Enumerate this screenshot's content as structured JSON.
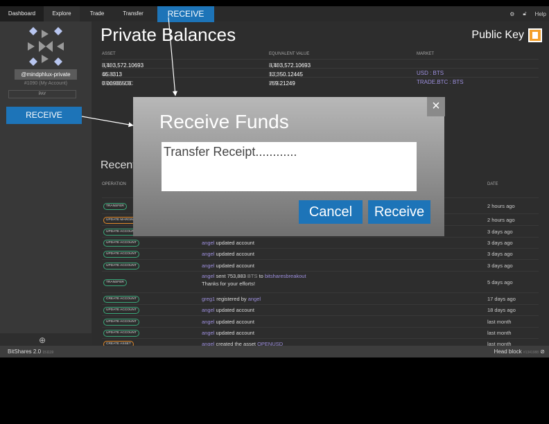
{
  "nav": {
    "items": [
      "Dashboard",
      "Explore",
      "Trade",
      "Transfer"
    ],
    "receive_label": "RECEIVE",
    "help": "Help"
  },
  "sidebar": {
    "account_name": "@mindphlux-private",
    "account_id": "#1090 (My Account)",
    "pay": "PAY",
    "receive": "RECEIVE",
    "plus": "⊕"
  },
  "balances": {
    "title": "Private Balances",
    "public_key": "Public Key",
    "headers": {
      "asset": "ASSET",
      "equivalent": "EQUIVALENT VALUE",
      "market": "MARKET"
    },
    "rows": [
      {
        "amount": "8,403,572.10693",
        "symbol": "BTS",
        "eq_amount": "8,403,572.10693",
        "eq_symbol": "BTS",
        "market": ""
      },
      {
        "amount": "46.3313",
        "symbol": "USD",
        "eq_amount": "13,350.12445",
        "eq_symbol": "BTS",
        "market": "USD : BTS"
      },
      {
        "amount": "0.00986508",
        "symbol": "TRADE.BTC",
        "eq_amount": "759.21249",
        "eq_symbol": "BTS",
        "market": "TRADE.BTC : BTS"
      }
    ]
  },
  "recent": {
    "title": "Recent",
    "headers": {
      "operation": "OPERATION",
      "date": "DATE"
    },
    "rows": [
      {
        "badge": "TRANSFER",
        "color": "green",
        "parts": [],
        "date": "2 hours ago"
      },
      {
        "badge": "UPDATE MARGIN",
        "color": "orange",
        "parts": [],
        "date": "2 hours ago"
      },
      {
        "badge": "UPDATE ACCOUNT",
        "color": "green",
        "parts": [],
        "date": "3 days ago"
      },
      {
        "badge": "UPDATE ACCOUNT",
        "color": "green",
        "parts": [
          {
            "t": "angel",
            "link": true
          },
          {
            "t": " updated account"
          }
        ],
        "date": "3 days ago"
      },
      {
        "badge": "UPDATE ACCOUNT",
        "color": "green",
        "parts": [
          {
            "t": "angel",
            "link": true
          },
          {
            "t": " updated account"
          }
        ],
        "date": "3 days ago"
      },
      {
        "badge": "UPDATE ACCOUNT",
        "color": "green",
        "parts": [
          {
            "t": "angel",
            "link": true
          },
          {
            "t": " updated account"
          }
        ],
        "date": "3 days ago"
      },
      {
        "badge": "TRANSFER",
        "color": "green",
        "parts": [
          {
            "t": "angel",
            "link": true
          },
          {
            "t": " sent 753,883 "
          },
          {
            "t": "BTS",
            "muted": true
          },
          {
            "t": " to "
          },
          {
            "t": "bitsharesbreakout",
            "link": true
          }
        ],
        "memo": "Thanks for your efforts!",
        "date": "5 days ago"
      },
      {
        "badge": "CREATE ACCOUNT",
        "color": "green",
        "parts": [
          {
            "t": "greg1",
            "link": true
          },
          {
            "t": " registered by "
          },
          {
            "t": "angel",
            "link": true
          }
        ],
        "date": "17 days ago"
      },
      {
        "badge": "UPDATE ACCOUNT",
        "color": "green",
        "parts": [
          {
            "t": "angel",
            "link": true
          },
          {
            "t": " updated account"
          }
        ],
        "date": "18 days ago"
      },
      {
        "badge": "UPDATE ACCOUNT",
        "color": "green",
        "parts": [
          {
            "t": "angel",
            "link": true
          },
          {
            "t": " updated account"
          }
        ],
        "date": "last month"
      },
      {
        "badge": "UPDATE ACCOUNT",
        "color": "green",
        "parts": [
          {
            "t": "angel",
            "link": true
          },
          {
            "t": " updated account"
          }
        ],
        "date": "last month"
      },
      {
        "badge": "CREATE ASSET",
        "color": "orange",
        "parts": [
          {
            "t": "angel",
            "link": true
          },
          {
            "t": " created the asset "
          },
          {
            "t": "OPENUSD",
            "link": true
          }
        ],
        "date": "last month"
      }
    ]
  },
  "status": {
    "version": "BitShares 2.0",
    "build": "151119",
    "head_block": "Head block",
    "block_num": "#1341988"
  },
  "modal": {
    "title": "Receive Funds",
    "input_value": "Transfer Receipt............",
    "cancel": "Cancel",
    "receive": "Receive",
    "close": "×"
  },
  "colors": {
    "accent": "#1d74b8",
    "badge_green": "#3aa87a",
    "badge_orange": "#e28a2b",
    "link": "#9d8fde"
  }
}
